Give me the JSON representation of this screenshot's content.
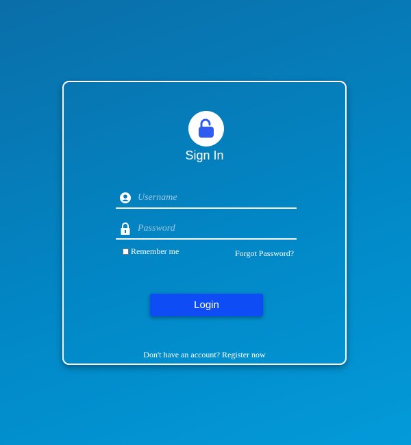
{
  "login_form": {
    "title": "Sign In",
    "username": {
      "placeholder": "Username",
      "value": "",
      "icon": "user-icon"
    },
    "password": {
      "placeholder": "Password",
      "value": "",
      "icon": "lock-icon"
    },
    "remember_label": "Remember me",
    "remember_checked": false,
    "forgot_label": "Forgot Password?",
    "login_label": "Login",
    "register_text": "Don't have an account? Register now",
    "header_icon": "unlock-icon"
  },
  "colors": {
    "background": "#0287c6",
    "accent_button": "#0e4cf5",
    "lock_icon": "#2f5bf0",
    "text": "#ffffff"
  }
}
